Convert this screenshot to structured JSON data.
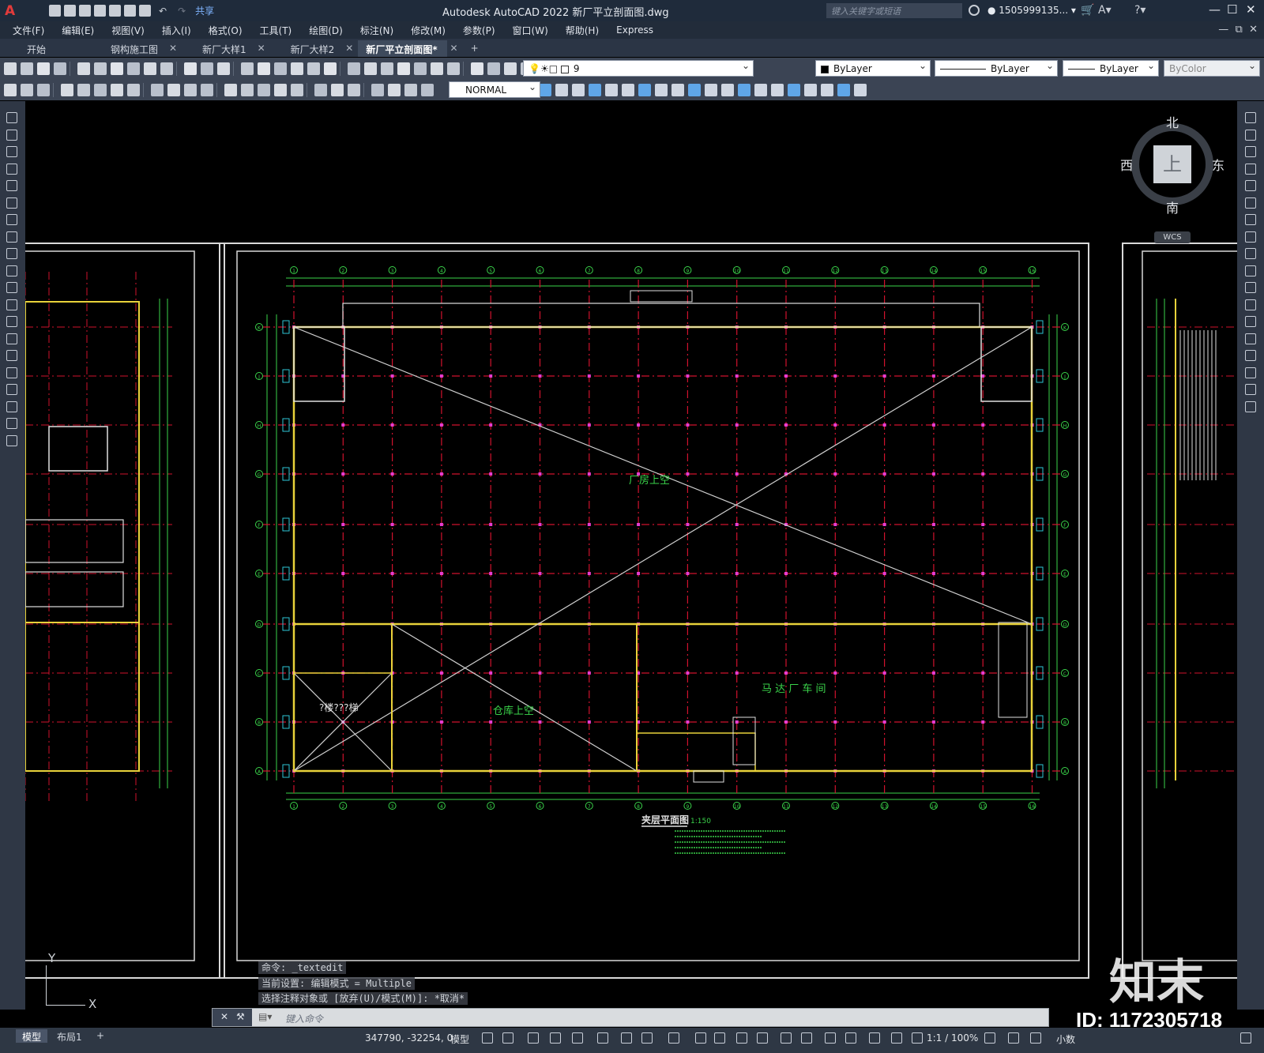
{
  "app": {
    "title": "Autodesk AutoCAD 2022    新厂平立剖面图.dwg",
    "share_label": "共享",
    "search_placeholder": "键入关键字或短语",
    "user": "1505999135...",
    "logo_letter": "A"
  },
  "menu": [
    "文件(F)",
    "编辑(E)",
    "视图(V)",
    "插入(I)",
    "格式(O)",
    "工具(T)",
    "绘图(D)",
    "标注(N)",
    "修改(M)",
    "参数(P)",
    "窗口(W)",
    "帮助(H)",
    "Express"
  ],
  "tabs": [
    {
      "label": "开始",
      "active": false
    },
    {
      "label": "钢构施工图",
      "active": false
    },
    {
      "label": "新厂大样1",
      "active": false
    },
    {
      "label": "新厂大样2",
      "active": false
    },
    {
      "label": "新厂平立剖面图*",
      "active": true
    }
  ],
  "toolbar": {
    "layer_value": "9",
    "color_value": "ByLayer",
    "linetype_value": "ByLayer",
    "lineweight_value": "ByLayer",
    "plotstyle_value": "ByColor",
    "textstyle_value": "NORMAL"
  },
  "viewcube": {
    "north": "北",
    "south": "南",
    "east": "东",
    "west": "西",
    "face": "上",
    "wcs": "WCS"
  },
  "drawing": {
    "plan_title": "夹层平面图",
    "plan_scale": "1:150",
    "label_void_factory": "厂房上空",
    "label_void_warehouse": "仓库上空",
    "label_motor_workshop": "马 达 厂 车 间",
    "label_garbled": "?楼???梯",
    "axis_numbers": [
      "1",
      "2",
      "3",
      "4",
      "5",
      "6",
      "7",
      "8",
      "9",
      "10",
      "11",
      "12",
      "13",
      "14",
      "15",
      "16"
    ],
    "axis_letters": [
      "K",
      "J",
      "H",
      "G",
      "F",
      "E",
      "D",
      "C",
      "B",
      "A"
    ]
  },
  "command": {
    "history": [
      "命令: _textedit",
      "当前设置: 编辑模式 = Multiple",
      "选择注释对象或 [放弃(U)/模式(M)]: *取消*"
    ],
    "placeholder": "键入命令"
  },
  "ucs": {
    "x": "X",
    "y": "Y"
  },
  "status": {
    "model_tab": "模型",
    "layout_tab": "布局1",
    "coords": "347790, -32254, 0",
    "space": "模型",
    "scale": "1:1 / 100%",
    "units": "小数"
  },
  "watermark": {
    "brand": "知末",
    "id": "ID: 1172305718"
  }
}
